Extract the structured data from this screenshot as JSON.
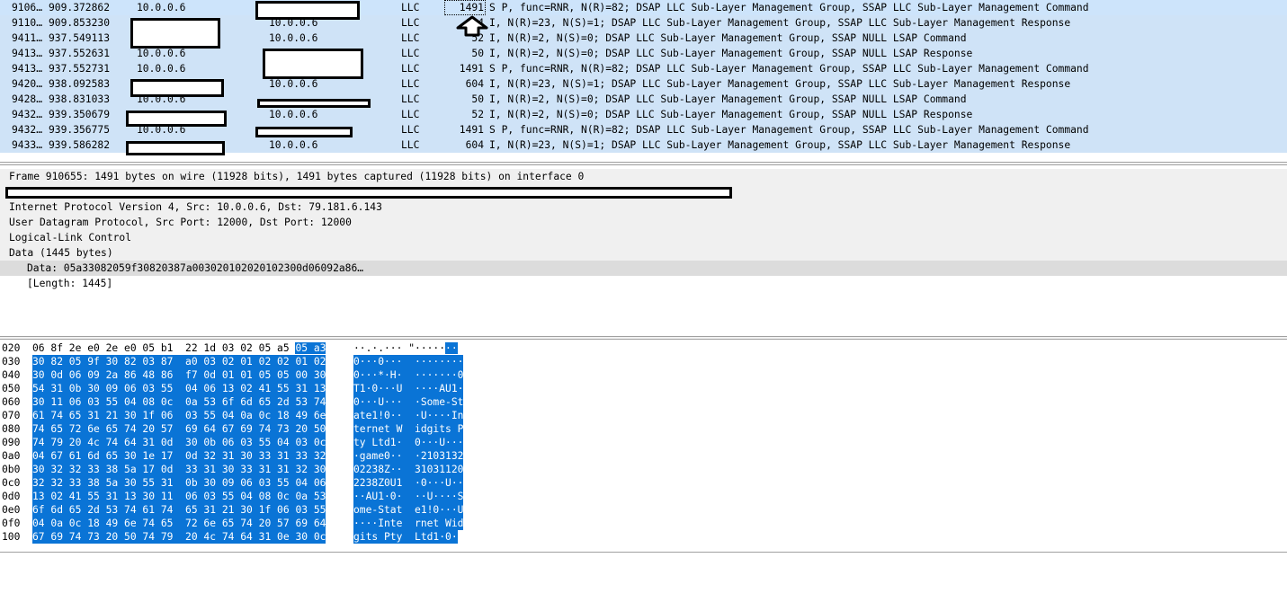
{
  "packets": [
    {
      "no": "9106…",
      "time": "909.372862",
      "src": "10.0.0.6",
      "dst": "",
      "proto": "LLC",
      "len": "1491",
      "info": "S P, func=RNR, N(R)=82; DSAP LLC Sub-Layer Management Group, SSAP LLC Sub-Layer Management Command",
      "selected": true
    },
    {
      "no": "9110…",
      "time": "909.853230",
      "src": "",
      "dst": "10.0.0.6",
      "proto": "LLC",
      "len": "604",
      "info": "I, N(R)=23, N(S)=1; DSAP LLC Sub-Layer Management Group, SSAP LLC Sub-Layer Management Response"
    },
    {
      "no": "9411…",
      "time": "937.549113",
      "src": "",
      "dst": "10.0.0.6",
      "proto": "LLC",
      "len": "52",
      "info": "I, N(R)=2, N(S)=0; DSAP LLC Sub-Layer Management Group, SSAP NULL LSAP Command"
    },
    {
      "no": "9413…",
      "time": "937.552631",
      "src": "10.0.0.6",
      "dst": "",
      "proto": "LLC",
      "len": "50",
      "info": "I, N(R)=2, N(S)=0; DSAP LLC Sub-Layer Management Group, SSAP NULL LSAP Response"
    },
    {
      "no": "9413…",
      "time": "937.552731",
      "src": "10.0.0.6",
      "dst": "",
      "proto": "LLC",
      "len": "1491",
      "info": "S P, func=RNR, N(R)=82; DSAP LLC Sub-Layer Management Group, SSAP LLC Sub-Layer Management Command"
    },
    {
      "no": "9420…",
      "time": "938.092583",
      "src": "",
      "dst": "10.0.0.6",
      "proto": "LLC",
      "len": "604",
      "info": "I, N(R)=23, N(S)=1; DSAP LLC Sub-Layer Management Group, SSAP LLC Sub-Layer Management Response"
    },
    {
      "no": "9428…",
      "time": "938.831033",
      "src": "10.0.0.6",
      "dst": "",
      "proto": "LLC",
      "len": "50",
      "info": "I, N(R)=2, N(S)=0; DSAP LLC Sub-Layer Management Group, SSAP NULL LSAP Command"
    },
    {
      "no": "9432…",
      "time": "939.350679",
      "src": "",
      "dst": "10.0.0.6",
      "proto": "LLC",
      "len": "52",
      "info": "I, N(R)=2, N(S)=0; DSAP LLC Sub-Layer Management Group, SSAP NULL LSAP Response"
    },
    {
      "no": "9432…",
      "time": "939.356775",
      "src": "10.0.0.6",
      "dst": "",
      "proto": "LLC",
      "len": "1491",
      "info": "S P, func=RNR, N(R)=82; DSAP LLC Sub-Layer Management Group, SSAP LLC Sub-Layer Management Command"
    },
    {
      "no": "9433…",
      "time": "939.586282",
      "src": "",
      "dst": "10.0.0.6",
      "proto": "LLC",
      "len": "604",
      "info": "I, N(R)=23, N(S)=1; DSAP LLC Sub-Layer Management Group, SSAP LLC Sub-Layer Management Response"
    }
  ],
  "details": {
    "frame": "Frame 910655: 1491 bytes on wire (11928 bits), 1491 bytes captured (11928 bits) on interface 0",
    "ip": "Internet Protocol Version 4, Src: 10.0.0.6, Dst: 79.181.6.143",
    "udp": "User Datagram Protocol, Src Port: 12000, Dst Port: 12000",
    "llc": "Logical-Link Control",
    "data": "Data (1445 bytes)",
    "data_value": "Data: 05a33082059f30820387a003020102020102300d06092a86…",
    "data_length": "[Length: 1445]"
  },
  "bytes": [
    {
      "off": "020",
      "hex_plain": "06 8f 2e e0 2e e0 05 b1  22 1d 03 02 05 a5 ",
      "hex_hl": "05 a3",
      "asc_plain": "··.·.··· \"·····",
      "asc_hl": "··"
    },
    {
      "off": "030",
      "hex_plain": "",
      "hex_hl": "30 82 05 9f 30 82 03 87  a0 03 02 01 02 02 01 02",
      "asc_plain": "",
      "asc_hl": "0···0···  ········"
    },
    {
      "off": "040",
      "hex_plain": "",
      "hex_hl": "30 0d 06 09 2a 86 48 86  f7 0d 01 01 05 05 00 30",
      "asc_plain": "",
      "asc_hl": "0···*·H·  ·······0"
    },
    {
      "off": "050",
      "hex_plain": "",
      "hex_hl": "54 31 0b 30 09 06 03 55  04 06 13 02 41 55 31 13",
      "asc_plain": "",
      "asc_hl": "T1·0···U  ····AU1·"
    },
    {
      "off": "060",
      "hex_plain": "",
      "hex_hl": "30 11 06 03 55 04 08 0c  0a 53 6f 6d 65 2d 53 74",
      "asc_plain": "",
      "asc_hl": "0···U···  ·Some-St"
    },
    {
      "off": "070",
      "hex_plain": "",
      "hex_hl": "61 74 65 31 21 30 1f 06  03 55 04 0a 0c 18 49 6e",
      "asc_plain": "",
      "asc_hl": "ate1!0··  ·U····In"
    },
    {
      "off": "080",
      "hex_plain": "",
      "hex_hl": "74 65 72 6e 65 74 20 57  69 64 67 69 74 73 20 50",
      "asc_plain": "",
      "asc_hl": "ternet W  idgits P"
    },
    {
      "off": "090",
      "hex_plain": "",
      "hex_hl": "74 79 20 4c 74 64 31 0d  30 0b 06 03 55 04 03 0c",
      "asc_plain": "",
      "asc_hl": "ty Ltd1·  0···U···"
    },
    {
      "off": "0a0",
      "hex_plain": "",
      "hex_hl": "04 67 61 6d 65 30 1e 17  0d 32 31 30 33 31 33 32",
      "asc_plain": "",
      "asc_hl": "·game0··  ·2103132"
    },
    {
      "off": "0b0",
      "hex_plain": "",
      "hex_hl": "30 32 32 33 38 5a 17 0d  33 31 30 33 31 31 32 30",
      "asc_plain": "",
      "asc_hl": "02238Z··  31031120"
    },
    {
      "off": "0c0",
      "hex_plain": "",
      "hex_hl": "32 32 33 38 5a 30 55 31  0b 30 09 06 03 55 04 06",
      "asc_plain": "",
      "asc_hl": "2238Z0U1  ·0···U··"
    },
    {
      "off": "0d0",
      "hex_plain": "",
      "hex_hl": "13 02 41 55 31 13 30 11  06 03 55 04 08 0c 0a 53",
      "asc_plain": "",
      "asc_hl": "··AU1·0·  ··U····S"
    },
    {
      "off": "0e0",
      "hex_plain": "",
      "hex_hl": "6f 6d 65 2d 53 74 61 74  65 31 21 30 1f 06 03 55",
      "asc_plain": "",
      "asc_hl": "ome-Stat  e1!0···U"
    },
    {
      "off": "0f0",
      "hex_plain": "",
      "hex_hl": "04 0a 0c 18 49 6e 74 65  72 6e 65 74 20 57 69 64",
      "asc_plain": "",
      "asc_hl": "····Inte  rnet Wid"
    },
    {
      "off": "100",
      "hex_plain": "",
      "hex_hl": "67 69 74 73 20 50 74 79  20 4c 74 64 31 0e 30 0c",
      "asc_plain": "",
      "asc_hl": "gits Pty  Ltd1·0·"
    }
  ]
}
